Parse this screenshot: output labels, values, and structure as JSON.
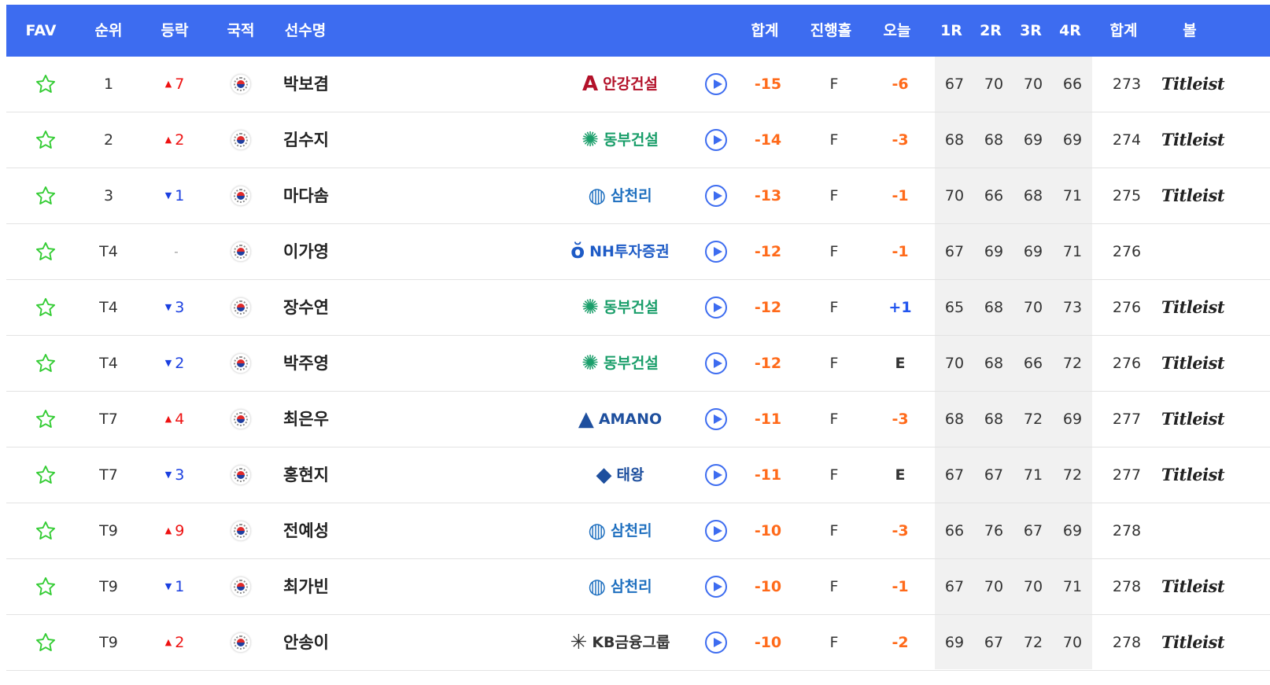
{
  "header": {
    "fav": "FAV",
    "rank": "순위",
    "move": "등락",
    "nation": "국적",
    "player": "선수명",
    "total": "합계",
    "thru": "진행홀",
    "today": "오늘",
    "r1": "1R",
    "r2": "2R",
    "r3": "3R",
    "r4": "4R",
    "strokes": "합계",
    "ball": "볼"
  },
  "colors": {
    "header_bg": "#3d6cf0",
    "star": "#33cc33",
    "score": "#ff6a1a",
    "up": "#ee1111",
    "down": "#1a3fe0",
    "even_today": "#333333"
  },
  "rows": [
    {
      "rank": "1",
      "move": {
        "dir": "up",
        "arrow": "▲",
        "val": "7"
      },
      "name": "박보겸",
      "sponsor": {
        "text": "안강건설",
        "mark": "A",
        "color": "#b3122a"
      },
      "total": "-15",
      "thru": "F",
      "today": "-6",
      "today_kind": "neg",
      "r1": "67",
      "r2": "70",
      "r3": "70",
      "r4": "66",
      "strokes": "273",
      "ball": "Titleist"
    },
    {
      "rank": "2",
      "move": {
        "dir": "up",
        "arrow": "▲",
        "val": "2"
      },
      "name": "김수지",
      "sponsor": {
        "text": "동부건설",
        "mark": "✺",
        "color": "#1a9e6a"
      },
      "total": "-14",
      "thru": "F",
      "today": "-3",
      "today_kind": "neg",
      "r1": "68",
      "r2": "68",
      "r3": "69",
      "r4": "69",
      "strokes": "274",
      "ball": "Titleist"
    },
    {
      "rank": "3",
      "move": {
        "dir": "down",
        "arrow": "▼",
        "val": "1"
      },
      "name": "마다솜",
      "sponsor": {
        "text": "삼천리",
        "mark": "◍",
        "color": "#1e6fbf"
      },
      "total": "-13",
      "thru": "F",
      "today": "-1",
      "today_kind": "neg",
      "r1": "70",
      "r2": "66",
      "r3": "68",
      "r4": "71",
      "strokes": "275",
      "ball": "Titleist"
    },
    {
      "rank": "T4",
      "move": {
        "dir": "same",
        "arrow": "",
        "val": "-"
      },
      "name": "이가영",
      "sponsor": {
        "text": "NH투자증권",
        "mark": "ŏ",
        "color": "#1e5bc6"
      },
      "total": "-12",
      "thru": "F",
      "today": "-1",
      "today_kind": "neg",
      "r1": "67",
      "r2": "69",
      "r3": "69",
      "r4": "71",
      "strokes": "276",
      "ball": ""
    },
    {
      "rank": "T4",
      "move": {
        "dir": "down",
        "arrow": "▼",
        "val": "3"
      },
      "name": "장수연",
      "sponsor": {
        "text": "동부건설",
        "mark": "✺",
        "color": "#1a9e6a"
      },
      "total": "-12",
      "thru": "F",
      "today": "+1",
      "today_kind": "pos",
      "r1": "65",
      "r2": "68",
      "r3": "70",
      "r4": "73",
      "strokes": "276",
      "ball": "Titleist"
    },
    {
      "rank": "T4",
      "move": {
        "dir": "down",
        "arrow": "▼",
        "val": "2"
      },
      "name": "박주영",
      "sponsor": {
        "text": "동부건설",
        "mark": "✺",
        "color": "#1a9e6a"
      },
      "total": "-12",
      "thru": "F",
      "today": "E",
      "today_kind": "even",
      "r1": "70",
      "r2": "68",
      "r3": "66",
      "r4": "72",
      "strokes": "276",
      "ball": "Titleist"
    },
    {
      "rank": "T7",
      "move": {
        "dir": "up",
        "arrow": "▲",
        "val": "4"
      },
      "name": "최은우",
      "sponsor": {
        "text": "AMANO",
        "mark": "▲",
        "color": "#1e4f9e"
      },
      "total": "-11",
      "thru": "F",
      "today": "-3",
      "today_kind": "neg",
      "r1": "68",
      "r2": "68",
      "r3": "72",
      "r4": "69",
      "strokes": "277",
      "ball": "Titleist"
    },
    {
      "rank": "T7",
      "move": {
        "dir": "down",
        "arrow": "▼",
        "val": "3"
      },
      "name": "홍현지",
      "sponsor": {
        "text": "태왕",
        "mark": "◆",
        "color": "#1e4f9e"
      },
      "total": "-11",
      "thru": "F",
      "today": "E",
      "today_kind": "even",
      "r1": "67",
      "r2": "67",
      "r3": "71",
      "r4": "72",
      "strokes": "277",
      "ball": "Titleist"
    },
    {
      "rank": "T9",
      "move": {
        "dir": "up",
        "arrow": "▲",
        "val": "9"
      },
      "name": "전예성",
      "sponsor": {
        "text": "삼천리",
        "mark": "◍",
        "color": "#1e6fbf"
      },
      "total": "-10",
      "thru": "F",
      "today": "-3",
      "today_kind": "neg",
      "r1": "66",
      "r2": "76",
      "r3": "67",
      "r4": "69",
      "strokes": "278",
      "ball": ""
    },
    {
      "rank": "T9",
      "move": {
        "dir": "down",
        "arrow": "▼",
        "val": "1"
      },
      "name": "최가빈",
      "sponsor": {
        "text": "삼천리",
        "mark": "◍",
        "color": "#1e6fbf"
      },
      "total": "-10",
      "thru": "F",
      "today": "-1",
      "today_kind": "neg",
      "r1": "67",
      "r2": "70",
      "r3": "70",
      "r4": "71",
      "strokes": "278",
      "ball": "Titleist"
    },
    {
      "rank": "T9",
      "move": {
        "dir": "up",
        "arrow": "▲",
        "val": "2"
      },
      "name": "안송이",
      "sponsor": {
        "text": "KB금융그룹",
        "mark": "✳",
        "color": "#333333"
      },
      "total": "-10",
      "thru": "F",
      "today": "-2",
      "today_kind": "neg",
      "r1": "69",
      "r2": "67",
      "r3": "72",
      "r4": "70",
      "strokes": "278",
      "ball": "Titleist"
    }
  ]
}
